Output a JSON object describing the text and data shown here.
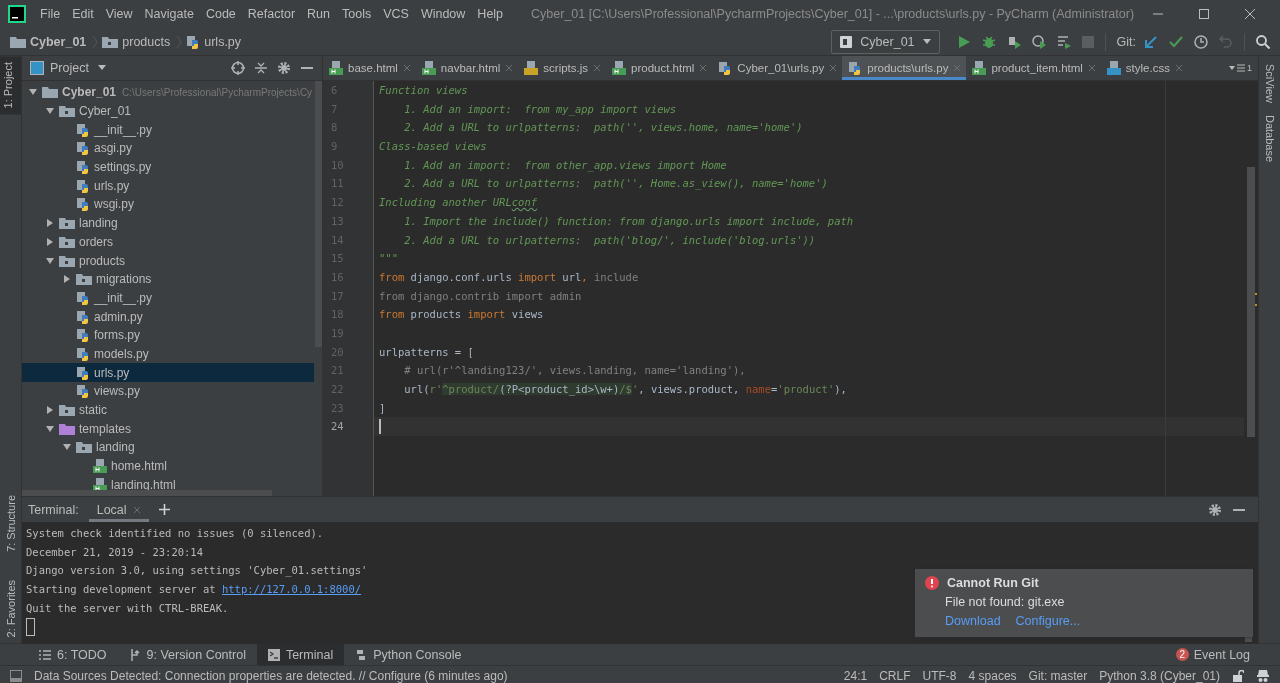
{
  "window": {
    "title": "Cyber_01 [C:\\Users\\Professional\\PycharmProjects\\Cyber_01] - ...\\products\\urls.py - PyCharm (Administrator)"
  },
  "menu": [
    "File",
    "Edit",
    "View",
    "Navigate",
    "Code",
    "Refactor",
    "Run",
    "Tools",
    "VCS",
    "Window",
    "Help"
  ],
  "breadcrumbs": [
    {
      "label": "Cyber_01",
      "kind": "project"
    },
    {
      "label": "products",
      "kind": "folder"
    },
    {
      "label": "urls.py",
      "kind": "python"
    }
  ],
  "run_config": {
    "label": "Cyber_01"
  },
  "git_label": "Git:",
  "left_tool_windows": [
    {
      "label": "1: Project",
      "selected": true
    },
    {
      "label": "7: Structure",
      "selected": false
    },
    {
      "label": "2: Favorites",
      "selected": false
    }
  ],
  "right_tool_windows": [
    "SciView",
    "Database"
  ],
  "project": {
    "title": "Project",
    "tree": [
      {
        "label": "Cyber_01",
        "path": "C:\\Users\\Professional\\PycharmProjects\\Cy",
        "kind": "root",
        "expanded": true,
        "selected": false,
        "children": [
          {
            "label": "Cyber_01",
            "kind": "folder",
            "expanded": true,
            "selected": false,
            "children": [
              {
                "label": "__init__.py",
                "kind": "python",
                "selected": false
              },
              {
                "label": "asgi.py",
                "kind": "python",
                "selected": false
              },
              {
                "label": "settings.py",
                "kind": "python",
                "selected": false
              },
              {
                "label": "urls.py",
                "kind": "python",
                "selected": false
              },
              {
                "label": "wsgi.py",
                "kind": "python",
                "selected": false
              }
            ]
          },
          {
            "label": "landing",
            "kind": "folder",
            "expanded": false,
            "selected": false
          },
          {
            "label": "orders",
            "kind": "folder",
            "expanded": false,
            "selected": false
          },
          {
            "label": "products",
            "kind": "folder",
            "expanded": true,
            "selected": false,
            "children": [
              {
                "label": "migrations",
                "kind": "folder",
                "expanded": false,
                "selected": false
              },
              {
                "label": "__init__.py",
                "kind": "python",
                "selected": false
              },
              {
                "label": "admin.py",
                "kind": "python",
                "selected": false
              },
              {
                "label": "forms.py",
                "kind": "python",
                "selected": false
              },
              {
                "label": "models.py",
                "kind": "python",
                "selected": false
              },
              {
                "label": "urls.py",
                "kind": "python",
                "selected": true
              },
              {
                "label": "views.py",
                "kind": "python",
                "selected": false
              }
            ]
          },
          {
            "label": "static",
            "kind": "folder",
            "expanded": false,
            "selected": false
          },
          {
            "label": "templates",
            "kind": "templates",
            "expanded": true,
            "selected": false,
            "children": [
              {
                "label": "landing",
                "kind": "folder",
                "expanded": true,
                "selected": false,
                "children": [
                  {
                    "label": "home.html",
                    "kind": "html",
                    "selected": false
                  },
                  {
                    "label": "landing.html",
                    "kind": "html",
                    "selected": false
                  }
                ]
              }
            ]
          }
        ]
      }
    ]
  },
  "editor": {
    "tabs": [
      {
        "label": "base.html",
        "kind": "html",
        "selected": false
      },
      {
        "label": "navbar.html",
        "kind": "html",
        "selected": false
      },
      {
        "label": "scripts.js",
        "kind": "js",
        "selected": false
      },
      {
        "label": "product.html",
        "kind": "html",
        "selected": false
      },
      {
        "label": "Cyber_01\\urls.py",
        "kind": "python",
        "selected": false
      },
      {
        "label": "products\\urls.py",
        "kind": "python",
        "selected": true
      },
      {
        "label": "product_item.html",
        "kind": "html",
        "selected": false
      },
      {
        "label": "style.css",
        "kind": "css",
        "selected": false
      }
    ],
    "overflow_count": "1",
    "lines": [
      {
        "number": "6",
        "current": false,
        "tokens": [
          {
            "kind": "comment",
            "text": "Function views"
          }
        ]
      },
      {
        "number": "7",
        "current": false,
        "tokens": [
          {
            "kind": "comment",
            "text": "    1. Add an import:  from my_app import views"
          }
        ]
      },
      {
        "number": "8",
        "current": false,
        "tokens": [
          {
            "kind": "comment",
            "text": "    2. Add a URL to urlpatterns:  path('', views.home, name='home')"
          }
        ]
      },
      {
        "number": "9",
        "current": false,
        "tokens": [
          {
            "kind": "comment",
            "text": "Class-based views"
          }
        ]
      },
      {
        "number": "10",
        "current": false,
        "tokens": [
          {
            "kind": "comment",
            "text": "    1. Add an import:  from other_app.views import Home"
          }
        ]
      },
      {
        "number": "11",
        "current": false,
        "tokens": [
          {
            "kind": "comment",
            "text": "    2. Add a URL to urlpatterns:  path('', Home.as_view(), name='home')"
          }
        ]
      },
      {
        "number": "12",
        "current": false,
        "tokens": [
          {
            "kind": "comment",
            "text": "Including another URL"
          },
          {
            "kind": "typo",
            "text": "conf"
          }
        ]
      },
      {
        "number": "13",
        "current": false,
        "tokens": [
          {
            "kind": "comment",
            "text": "    1. Import the include() function: from django.urls import include, path"
          }
        ]
      },
      {
        "number": "14",
        "current": false,
        "tokens": [
          {
            "kind": "comment",
            "text": "    2. Add a URL to urlpatterns:  path('blog/', include('blog.urls'))"
          }
        ]
      },
      {
        "number": "15",
        "current": false,
        "tokens": [
          {
            "kind": "comment",
            "text": "\"\"\""
          }
        ]
      },
      {
        "number": "16",
        "current": false,
        "tokens": [
          {
            "kind": "keyword",
            "text": "from"
          },
          {
            "kind": "plain",
            "text": " django.conf.urls "
          },
          {
            "kind": "keyword",
            "text": "import"
          },
          {
            "kind": "plain",
            "text": " url"
          },
          {
            "kind": "keyword",
            "text": ","
          },
          {
            "kind": "dim",
            "text": " include"
          }
        ]
      },
      {
        "number": "17",
        "current": false,
        "tokens": [
          {
            "kind": "dim",
            "text": "from django.contrib import admin"
          }
        ]
      },
      {
        "number": "18",
        "current": false,
        "tokens": [
          {
            "kind": "keyword",
            "text": "from"
          },
          {
            "kind": "plain",
            "text": " products "
          },
          {
            "kind": "keyword",
            "text": "import"
          },
          {
            "kind": "plain",
            "text": " views"
          }
        ]
      },
      {
        "number": "19",
        "current": false
      },
      {
        "number": "20",
        "current": false,
        "tokens": [
          {
            "kind": "plain",
            "text": "urlpatterns = ["
          }
        ]
      },
      {
        "number": "21",
        "current": false,
        "tokens": [
          {
            "kind": "dim",
            "text": "    # url(r'^landing123/', views.landing, name='landing'),"
          }
        ]
      },
      {
        "number": "22",
        "current": false,
        "tokens": [
          {
            "kind": "plain",
            "text": "    url("
          },
          {
            "kind": "string",
            "text": "r'"
          },
          {
            "kind": "regex",
            "text": "^product/"
          },
          {
            "kind": "regexgroup",
            "text": "(?P<product_id>\\w+)"
          },
          {
            "kind": "regex",
            "text": "/$"
          },
          {
            "kind": "string",
            "text": "'"
          },
          {
            "kind": "plain",
            "text": ", views.product, "
          },
          {
            "kind": "param",
            "text": "name"
          },
          {
            "kind": "plain",
            "text": "="
          },
          {
            "kind": "string",
            "text": "'product'"
          },
          {
            "kind": "plain",
            "text": "),"
          }
        ]
      },
      {
        "number": "23",
        "current": false,
        "tokens": [
          {
            "kind": "plain",
            "text": "]"
          }
        ]
      },
      {
        "number": "24",
        "current": true
      }
    ]
  },
  "terminal": {
    "title": "Terminal:",
    "tabs": [
      {
        "label": "Local",
        "selected": true
      }
    ],
    "lines": [
      {
        "text": "System check identified no issues (0 silenced)."
      },
      {
        "text": "December 21, 2019 - 23:20:14"
      },
      {
        "text": "Django version 3.0, using settings 'Cyber_01.settings'"
      },
      {
        "text": "Starting development server at ",
        "link": "http://127.0.0.1:8000/"
      },
      {
        "text": "Quit the server with CTRL-BREAK."
      }
    ]
  },
  "notification": {
    "title": "Cannot Run Git",
    "message": "File not found: git.exe",
    "actions": [
      "Download",
      "Configure..."
    ]
  },
  "tool_tabs": [
    {
      "label": "6: TODO",
      "kind": "todo",
      "selected": false
    },
    {
      "label": "9: Version Control",
      "kind": "vcs",
      "selected": false
    },
    {
      "label": "Terminal",
      "kind": "terminal",
      "selected": true
    },
    {
      "label": "Python Console",
      "kind": "console",
      "selected": false
    }
  ],
  "event_log": {
    "label": "Event Log",
    "count": "2"
  },
  "status_bar": {
    "message": "Data Sources Detected: Connection properties are detected. // Configure (6 minutes ago)",
    "items": [
      "24:1",
      "CRLF",
      "UTF-8",
      "4 spaces",
      "Git: master",
      "Python 3.8 (Cyber_01)"
    ]
  }
}
